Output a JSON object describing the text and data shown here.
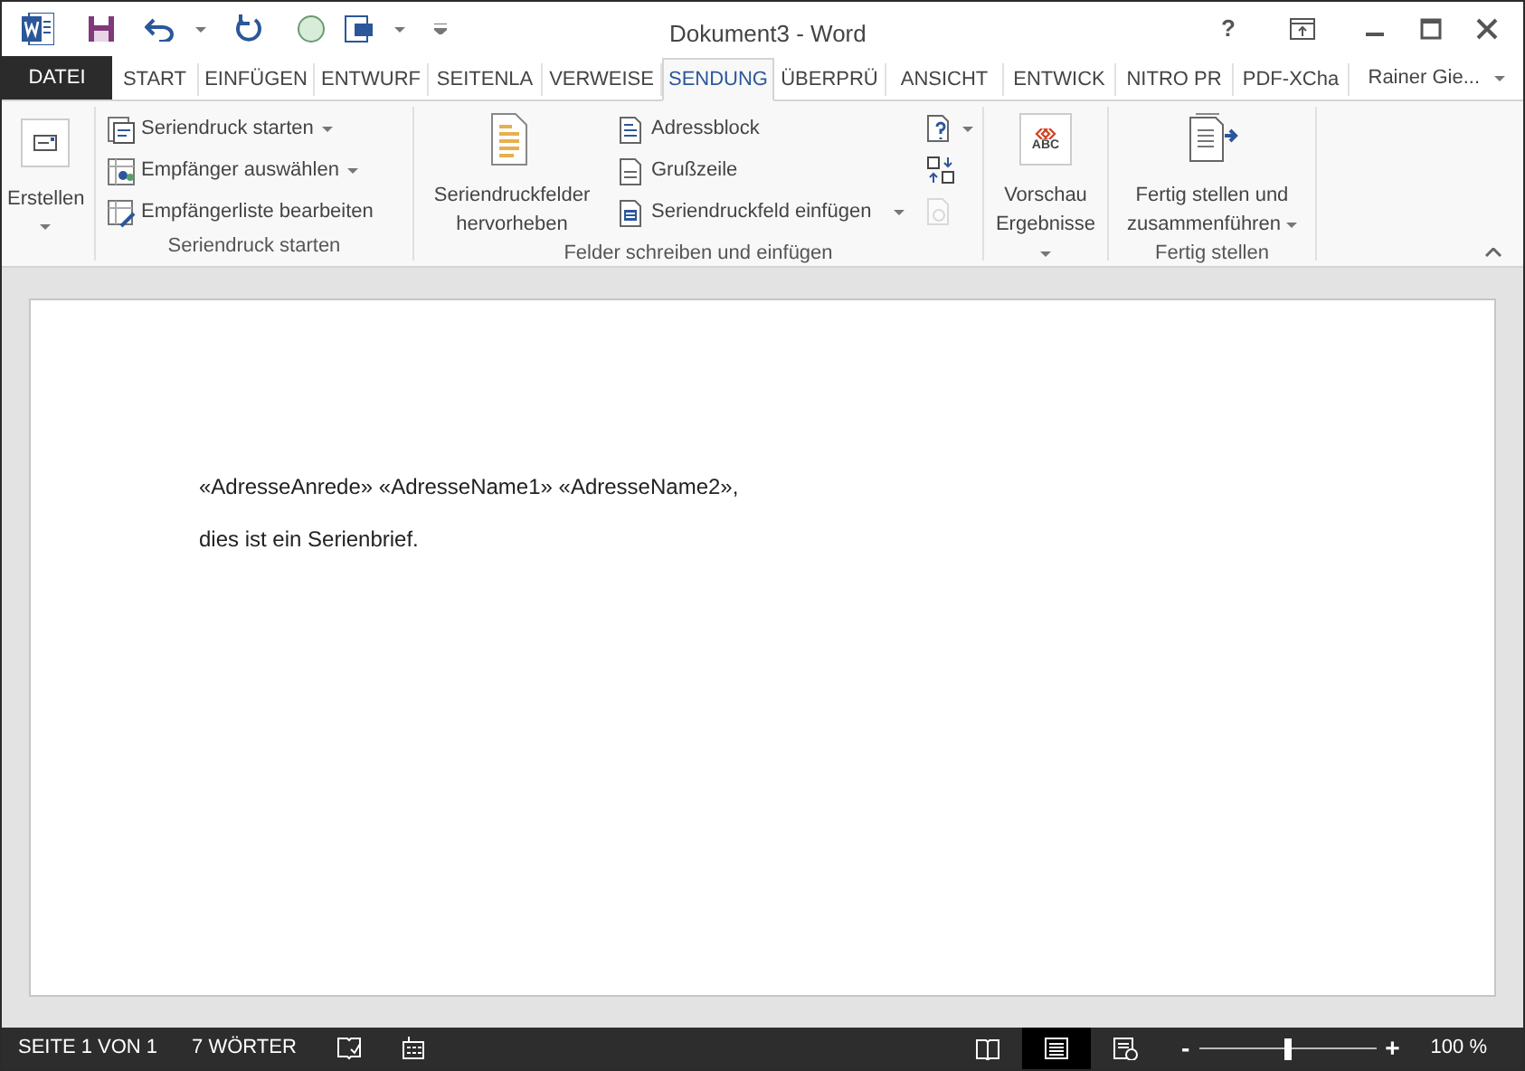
{
  "window": {
    "title": "Dokument3 - Word",
    "help": "?"
  },
  "tabs": [
    {
      "label": "DATEI",
      "kind": "file",
      "selected": false
    },
    {
      "label": "START",
      "kind": "tab",
      "selected": false
    },
    {
      "label": "EINFÜGEN",
      "kind": "tab",
      "selected": false
    },
    {
      "label": "ENTWURF",
      "kind": "tab",
      "selected": false
    },
    {
      "label": "SEITENLA",
      "kind": "tab",
      "selected": false
    },
    {
      "label": "VERWEISE",
      "kind": "tab",
      "selected": false
    },
    {
      "label": "SENDUNG",
      "kind": "tab",
      "selected": true
    },
    {
      "label": "ÜBERPRÜ",
      "kind": "tab",
      "selected": false
    },
    {
      "label": "ANSICHT",
      "kind": "tab",
      "selected": false
    },
    {
      "label": "ENTWICK",
      "kind": "tab",
      "selected": false
    },
    {
      "label": "NITRO PR",
      "kind": "tab",
      "selected": false
    },
    {
      "label": "PDF-XCha",
      "kind": "tab",
      "selected": false
    }
  ],
  "account": "Rainer Gie...",
  "ribbon": {
    "groups": [
      {
        "items": [
          {
            "kind": "large",
            "label": "Erstellen",
            "dropdown": true,
            "disabled": false
          }
        ]
      },
      {
        "label": "Seriendruck starten",
        "items": [
          {
            "kind": "small",
            "label": "Seriendruck starten",
            "dropdown": true,
            "disabled": false
          },
          {
            "kind": "small",
            "label": "Empfänger auswählen",
            "dropdown": true,
            "disabled": false
          },
          {
            "kind": "small",
            "label": "Empfängerliste bearbeiten",
            "dropdown": false,
            "disabled": false
          }
        ]
      },
      {
        "label": "Felder schreiben und einfügen",
        "items": [
          {
            "kind": "large",
            "label": "Seriendruckfelder hervorheben",
            "dropdown": false,
            "disabled": false
          },
          {
            "kind": "small",
            "label": "Adressblock",
            "dropdown": false,
            "disabled": false
          },
          {
            "kind": "small",
            "label": "Grußzeile",
            "dropdown": false,
            "disabled": false
          },
          {
            "kind": "small",
            "label": "Seriendruckfeld einfügen",
            "dropdown": true,
            "disabled": false
          },
          {
            "kind": "icon",
            "dropdown": true,
            "disabled": false
          },
          {
            "kind": "icon",
            "dropdown": false,
            "disabled": false
          },
          {
            "kind": "icon",
            "dropdown": false,
            "disabled": true
          }
        ]
      },
      {
        "items": [
          {
            "kind": "large",
            "label": "Vorschau Ergebnisse",
            "badge": "ABC",
            "dropdown": true,
            "disabled": false
          }
        ]
      },
      {
        "label": "Fertig stellen",
        "items": [
          {
            "kind": "large",
            "label": "Fertig stellen und zusammenführen",
            "dropdown": true,
            "disabled": false
          }
        ]
      }
    ]
  },
  "document": {
    "paragraphs": [
      "«AdresseAnrede» «AdresseName1» «AdresseName2»,",
      "dies ist ein Serienbrief."
    ]
  },
  "status_bar": {
    "page": "SEITE 1 VON 1",
    "words": "7 WÖRTER",
    "views": [
      {
        "kind": "read",
        "selected": false
      },
      {
        "kind": "print",
        "selected": true
      },
      {
        "kind": "web",
        "selected": false
      }
    ],
    "zoom": {
      "level": 0.5,
      "minus": "-",
      "plus": "+",
      "reading": "100 %"
    }
  }
}
